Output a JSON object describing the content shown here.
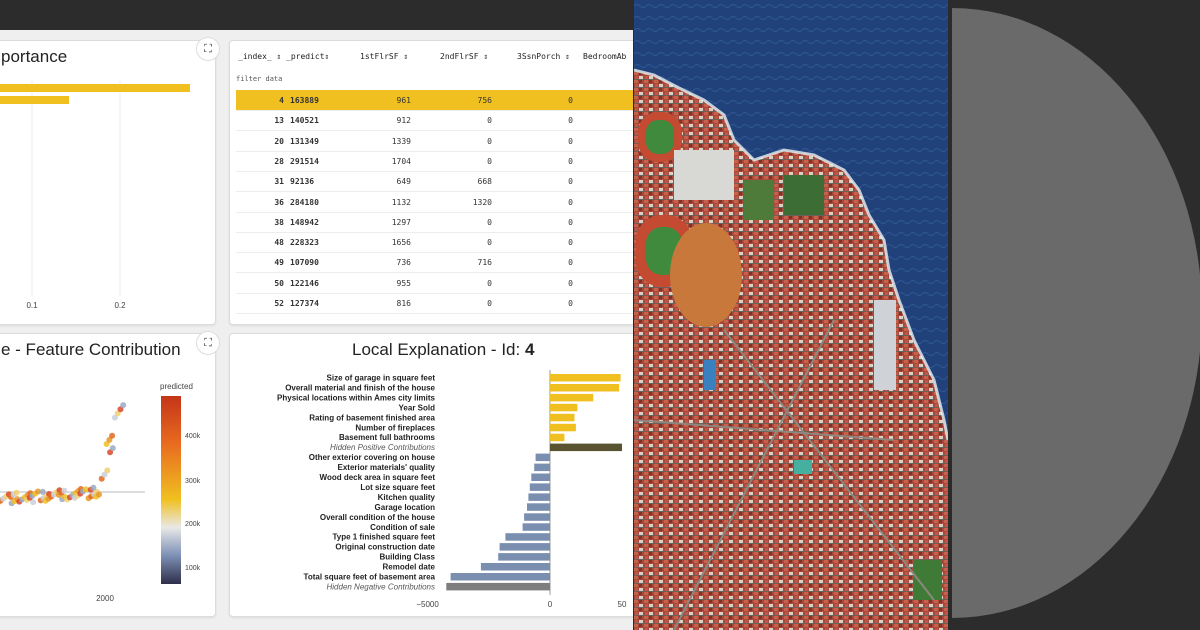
{
  "feature_importance": {
    "title": "portance",
    "ticks": [
      "0.1",
      "0.2"
    ]
  },
  "table": {
    "headers": [
      "_index_ ⇕",
      "_predict⇕",
      "1stFlrSF ⇕",
      "2ndFlrSF ⇕",
      "3SsnPorch ⇕",
      "BedroomAb"
    ],
    "filter_placeholder": "filter data",
    "rows": [
      [
        "4",
        "163889",
        "961",
        "756",
        "0"
      ],
      [
        "13",
        "140521",
        "912",
        "0",
        "0"
      ],
      [
        "20",
        "131349",
        "1339",
        "0",
        "0"
      ],
      [
        "28",
        "291514",
        "1704",
        "0",
        "0"
      ],
      [
        "31",
        "92136",
        "649",
        "668",
        "0"
      ],
      [
        "36",
        "284180",
        "1132",
        "1320",
        "0"
      ],
      [
        "38",
        "148942",
        "1297",
        "0",
        "0"
      ],
      [
        "48",
        "228323",
        "1656",
        "0",
        "0"
      ],
      [
        "49",
        "107090",
        "736",
        "716",
        "0"
      ],
      [
        "50",
        "122146",
        "955",
        "0",
        "0"
      ],
      [
        "52",
        "127374",
        "816",
        "0",
        "0"
      ]
    ],
    "selected_row": 0
  },
  "feature_contribution": {
    "title": "e - Feature Contribution",
    "legend_title": "predicted",
    "colorbar_ticks": [
      "400k",
      "300k",
      "200k",
      "100k"
    ],
    "x_tick": "2000"
  },
  "local_explanation": {
    "title_prefix": "Local Explanation - Id: ",
    "title_id": "4",
    "x_ticks": [
      "−5000",
      "0",
      "50"
    ],
    "chart_data": {
      "type": "bar",
      "orientation": "horizontal",
      "categories": [
        "Size of garage in square feet",
        "Overall material and finish of the house",
        "Physical locations within Ames city limits",
        "Year Sold",
        "Rating of basement finished area",
        "Number of fireplaces",
        "Basement full bathrooms",
        "Hidden Positive Contributions",
        "Other exterior covering on house",
        "Exterior materials' quality",
        "Wood deck area in square feet",
        "Lot size square feet",
        "Kitchen quality",
        "Garage location",
        "Overall condition of the house",
        "Condition of sale",
        "Type 1 finished square feet",
        "Original construction date",
        "Building Class",
        "Remodel date",
        "Total square feet of basement area",
        "Hidden Negative Contributions"
      ],
      "values": [
        4900,
        4800,
        3000,
        1900,
        1700,
        1800,
        1000,
        5000,
        -1000,
        -1100,
        -1300,
        -1400,
        -1500,
        -1600,
        -1800,
        -1900,
        -3100,
        -3500,
        -3600,
        -4800,
        -6900,
        -7200
      ],
      "xlim": [
        -7500,
        5000
      ],
      "colors": {
        "positive": "#f0c020",
        "negative": "#7a8fb0",
        "hidden_positive": "#5a5330",
        "hidden_negative": "#7e7e7e"
      }
    }
  }
}
